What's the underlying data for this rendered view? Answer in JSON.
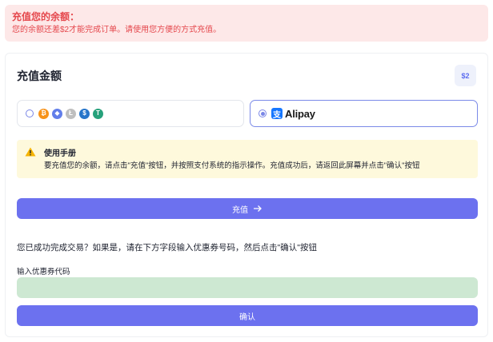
{
  "alert": {
    "title": "充值您的余额：",
    "message": "您的余额还差$2才能完成订单。请使用您方便的方式充值。"
  },
  "card": {
    "title": "充值金额",
    "amount": "$2"
  },
  "payment_methods": {
    "crypto": {
      "selected": false,
      "coins": [
        {
          "icon": "bitcoin-icon",
          "glyph": "₿",
          "color": "#f7931a"
        },
        {
          "icon": "ethereum-icon",
          "glyph": "◆",
          "color": "#627eea"
        },
        {
          "icon": "litecoin-icon",
          "glyph": "Ł",
          "color": "#bfbfbf"
        },
        {
          "icon": "usdc-icon",
          "glyph": "$",
          "color": "#2775ca"
        },
        {
          "icon": "tether-icon",
          "glyph": "T",
          "color": "#26a17b"
        }
      ]
    },
    "alipay": {
      "selected": true,
      "logo_glyph": "支",
      "label": "Alipay"
    }
  },
  "manual": {
    "title": "使用手册",
    "text": "要充值您的余额，请点击\"充值\"按钮，并按照支付系统的指示操作。充值成功后，请返回此屏幕并点击\"确认\"按钮"
  },
  "recharge_button": {
    "label": "充值"
  },
  "success_message": "您已成功完成交易？如果是，请在下方字段输入优惠券号码，然后点击\"确认\"按钮",
  "coupon": {
    "label": "输入优惠券代码",
    "value": "",
    "placeholder": ""
  },
  "confirm_button": {
    "label": "确认"
  },
  "colors": {
    "accent": "#6c71ef",
    "alert_text": "#e5484d",
    "alert_bg": "#fde8e8",
    "manual_bg": "#fef9dc",
    "coupon_bg": "#cde8d2"
  }
}
